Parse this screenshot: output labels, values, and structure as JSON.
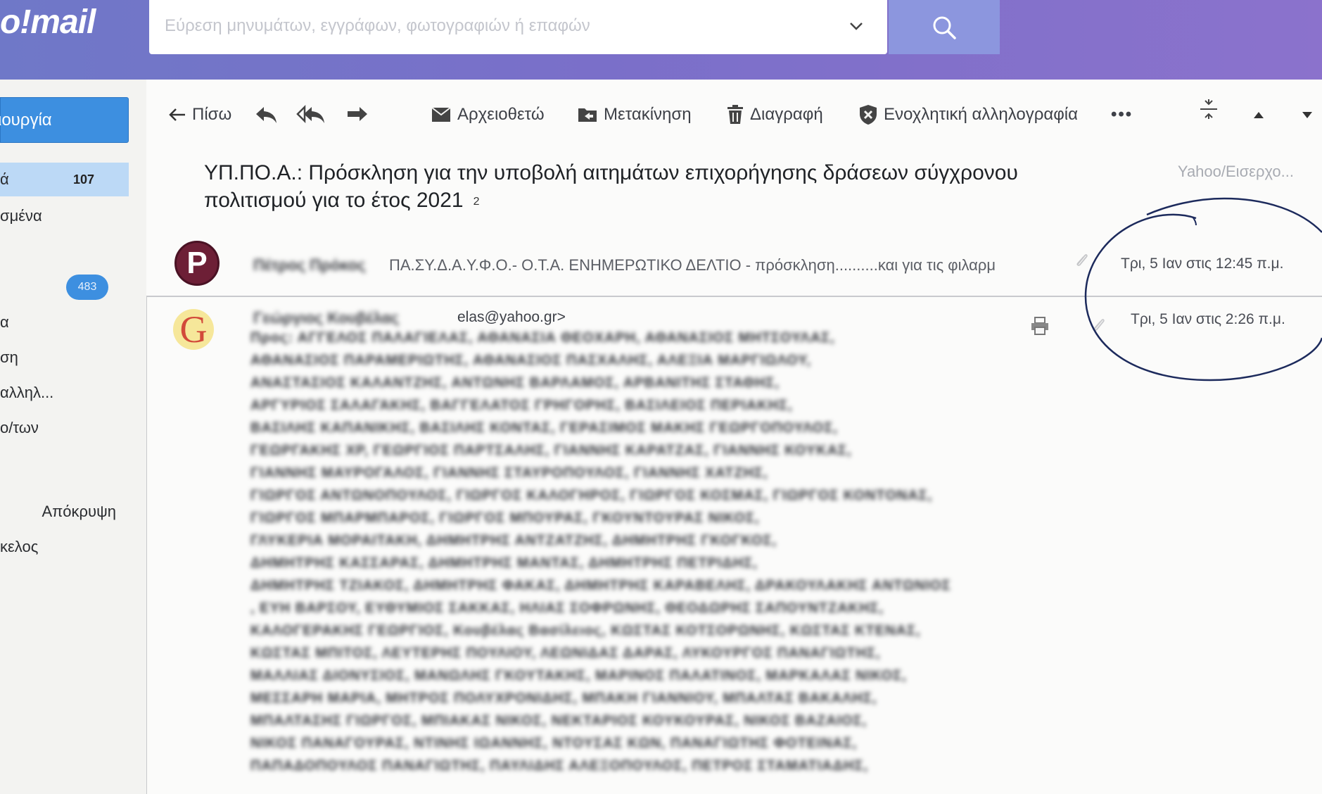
{
  "app": {
    "logo_text": "o!mail"
  },
  "search": {
    "placeholder": "Εύρεση μηνυμάτων, εγγράφων, φωτογραφιών ή επαφών"
  },
  "sidebar": {
    "compose_label": "ιουργία",
    "items": [
      {
        "label": "ά",
        "count": "107"
      },
      {
        "label": "σμένα"
      },
      {
        "badge": "483"
      },
      {
        "label": "α"
      },
      {
        "label": "ση"
      },
      {
        "label": "αλληλ..."
      },
      {
        "label": "ο/των"
      },
      {
        "label": "Απόκρυψη"
      },
      {
        "label": "κελος"
      }
    ]
  },
  "toolbar": {
    "back_label": "Πίσω",
    "archive_label": "Αρχειοθετώ",
    "move_label": "Μετακίνηση",
    "delete_label": "Διαγραφή",
    "spam_label": "Ενοχλητική αλληλογραφία",
    "more_label": "•••"
  },
  "message": {
    "subject": "ΥΠ.ΠΟ.Α.: Πρόσκληση για την υποβολή αιτημάτων επιχορήγησης δράσεων σύγχρονου πολιτισμού για το έτος 2021",
    "thread_count": "2",
    "folder": "Yahoo/Εισερχο...",
    "thread": [
      {
        "avatar_letter": "P",
        "sender": "Πέτρος Πρόκος",
        "preview": "ΠΑ.ΣΥ.Δ.Α.Υ.Φ.Ο.- Ο.Τ.Α. ΕΝΗΜΕΡΩΤΙΚΟ ΔΕΛΤΙΟ - πρόσκληση..........και για τις φιλαρμ",
        "date": "Τρι, 5 Ιαν στις 12:45 π.μ."
      },
      {
        "avatar_letter": "G",
        "sender": "Γεώργιος Κουβέλας",
        "email_suffix": "elas@yahoo.gr>",
        "date": "Τρι, 5 Ιαν στις 2:26 π.μ.",
        "recipients": [
          "Προς: ΑΓΓΕΛΟΣ ΠΑΛΑΓΙΕΛΑΣ, ΑΘΑΝΑΣΙΑ ΘΕΟΧΑΡΗ, ΑΘΑΝΑΣΙΟΣ ΜΗΤΣΟΥΛΑΣ,",
          "ΑΘΑΝΑΣΙΟΣ ΠΑΡΑΜΕΡΙΩΤΗΣ, ΑΘΑΝΑΣΙΟΣ ΠΑΣΧΑΛΗΣ, ΑΛΕΞΙΑ ΜΑΡΓΙΩΛΟΥ,",
          "ΑΝΑΣΤΑΣΙΟΣ ΚΑΛΑΝΤΖΗΣ, ΑΝΤΩΝΗΣ ΒΑΡΛΑΜΟΣ, ΑΡΒΑΝΙΤΗΣ ΣΤΑΘΗΣ,",
          "ΑΡΓΥΡΙΟΣ ΣΑΛΑΓΑΚΗΣ, ΒΑΓΓΕΛΑΤΟΣ ΓΡΗΓΟΡΗΣ, ΒΑΣΙΛΕΙΟΣ ΠΕΡΙΑΚΗΣ,",
          "ΒΑΣΙΛΗΣ ΚΑΠΑΝΙΚΗΣ, ΒΑΣΙΛΗΣ ΚΟΝΤΑΣ, ΓΕΡΑΣΙΜΟΣ ΜΑΚΗΣ ΓΕΩΡΓΟΠΟΥΛΟΣ,",
          "ΓΕΩΡΓΑΚΗΣ ΧΡ, ΓΕΩΡΓΙΟΣ ΠΑΡΤΣΑΛΗΣ, ΓΙΑΝΝΗΣ ΚΑΡΑΤΖΑΣ, ΓΙΑΝΝΗΣ ΚΟΥΚΑΣ,",
          "ΓΙΑΝΝΗΣ ΜΑΥΡΟΓΑΛΟΣ, ΓΙΑΝΝΗΣ ΣΤΑΥΡΟΠΟΥΛΟΣ, ΓΙΑΝΝΗΣ ΧΑΤΖΗΣ,",
          "ΓΙΩΡΓΟΣ ΑΝΤΩΝΟΠΟΥΛΟΣ, ΓΙΩΡΓΟΣ ΚΑΛΟΓΗΡΟΣ, ΓΙΩΡΓΟΣ ΚΟΣΜΑΣ, ΓΙΩΡΓΟΣ ΚΟΝΤΟΝΑΣ,",
          "ΓΙΩΡΓΟΣ ΜΠΑΡΜΠΑΡΟΣ, ΓΙΩΡΓΟΣ ΜΠΟΥΡΑΣ, ΓΚΟΥΝΤΟΥΡΑΣ ΝΙΚΟΣ,",
          "ΓΛΥΚΕΡΙΑ ΜΟΡΑΙΤΑΚΗ, ΔΗΜΗΤΡΗΣ ΑΝΤΖΑΤΖΗΣ, ΔΗΜΗΤΡΗΣ ΓΚΟΓΚΟΣ,",
          "ΔΗΜΗΤΡΗΣ ΚΑΣΣΑΡΑΣ, ΔΗΜΗΤΡΗΣ ΜΑΝΤΑΣ, ΔΗΜΗΤΡΗΣ ΠΕΤΡΙΔΗΣ,",
          "ΔΗΜΗΤΡΗΣ ΤΖΙΑΚΟΣ, ΔΗΜΗΤΡΗΣ ΦΑΚΑΣ, ΔΗΜΗΤΡΗΣ ΚΑΡΑΒΕΛΗΣ, ΔΡΑΚΟΥΛΑΚΗΣ ΑΝΤΩΝΙΟΣ",
          ", ΕΥΗ ΒΑΡΣΟΥ, ΕΥΘΥΜΙΟΣ ΣΑΚΚΑΣ, ΗΛΙΑΣ ΣΟΦΡΩΝΗΣ, ΘΕΟΔΩΡΗΣ ΣΑΠΟΥΝΤΖΑΚΗΣ,",
          "ΚΑΛΟΓΕΡΑΚΗΣ ΓΕΩΡΓΙΟΣ, Κουβέλας Βασίλειος, ΚΩΣΤΑΣ ΚΟΤΣΟΡΩΝΗΣ, ΚΩΣΤΑΣ ΚΤΕΝΑΣ,",
          "ΚΩΣΤΑΣ ΜΠΙΤΟΣ, ΛΕΥΤΕΡΗΣ ΠΟΥΛΙΟΥ, ΛΕΩΝΙΔΑΣ ΔΑΡΑΣ, ΛΥΚΟΥΡΓΟΣ ΠΑΝΑΓΙΩΤΗΣ,",
          "ΜΑΛΛΙΑΣ ΔΙΟΝΥΣΙΟΣ, ΜΑΝΩΛΗΣ ΓΚΟΥΤΑΚΗΣ, ΜΑΡΙΝΟΣ ΠΑΛΑΤΙΝΟΣ, ΜΑΡΚΑΛΑΣ ΝΙΚΟΣ,",
          "ΜΕΣΣΑΡΗ ΜΑΡΙΑ, ΜΗΤΡΟΣ ΠΟΛΥΧΡΟΝΙΔΗΣ, ΜΠΑΚΗ ΓΙΑΝΝΙΟΥ, ΜΠΑΛΤΑΣ ΒΑΚΑΛΗΣ,",
          "ΜΠΑΛΤΑΣΗΣ ΓΙΩΡΓΟΣ, ΜΠΙΑΚΑΣ ΝΙΚΟΣ, ΝΕΚΤΑΡΙΟΣ ΚΟΥΚΟΥΡΑΣ, ΝΙΚΟΣ ΒΑΖΑΙΟΣ,",
          "ΝΙΚΟΣ ΠΑΝΑΓΟΥΡΑΣ, ΝΤΙΝΗΣ ΙΩΑΝΝΗΣ, ΝΤΟΥΣΑΣ ΚΩΝ, ΠΑΝΑΓΙΩΤΗΣ ΦΟΤΕΙΝΑΣ,",
          "ΠΑΠΑΔΟΠΟΥΛΟΣ ΠΑΝΑΓΙΩΤΗΣ, ΠΑΥΛΙΔΗΣ ΑΛΕΞΟΠΟΥΛΟΣ, ΠΕΤΡΟΣ ΣΤΑΜΑΤΙΑΔΗΣ,"
        ]
      }
    ]
  }
}
